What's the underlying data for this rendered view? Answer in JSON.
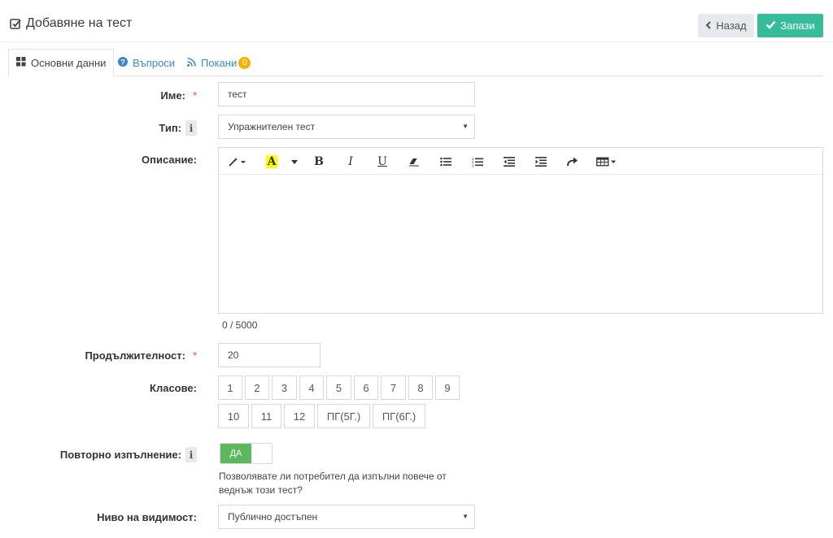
{
  "header": {
    "title": "Добавяне на тест",
    "back_label": "Назад",
    "save_label": "Запази"
  },
  "tabs": [
    {
      "label": "Основни данни",
      "icon": "grid-icon",
      "active": true
    },
    {
      "label": "Въпроси",
      "icon": "question-circle-icon",
      "active": false
    },
    {
      "label": "Покани",
      "icon": "rss-icon",
      "badge": "0",
      "active": false
    }
  ],
  "form": {
    "name": {
      "label": "Име:",
      "required": "*",
      "value": "тест"
    },
    "type": {
      "label": "Тип:",
      "value": "Упражнителен тест"
    },
    "description": {
      "label": "Описание:",
      "counter": "0 / 5000"
    },
    "duration": {
      "label": "Продължителност:",
      "required": "*",
      "value": "20"
    },
    "grades": {
      "label": "Класове:",
      "options": [
        "1",
        "2",
        "3",
        "4",
        "5",
        "6",
        "7",
        "8",
        "9",
        "10",
        "11",
        "12",
        "ПГ(5Г.)",
        "ПГ(6Г.)"
      ]
    },
    "repeat": {
      "label": "Повторно изпълнение:",
      "toggle_label": "ДА",
      "help": "Позволявате ли потребител да изпълни повече от веднъж този тест?"
    },
    "visibility": {
      "label": "Ниво на видимост:",
      "value": "Публично достъпен"
    }
  },
  "editor_toolbar": {
    "bold": "B",
    "italic": "I",
    "underline": "U",
    "highlight": "A"
  },
  "colors": {
    "save": "#37bc9b",
    "back": "#e6e9ed",
    "toggle_on": "#5cb85c",
    "badge": "#f0b400",
    "tab_link": "#3a87c8",
    "required": "#e74c3c"
  }
}
